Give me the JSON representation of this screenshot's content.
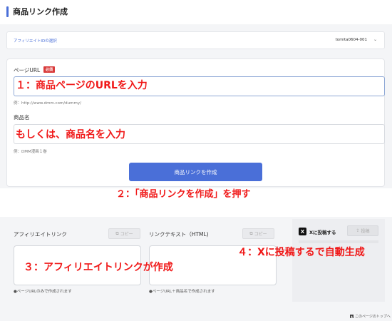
{
  "header": {
    "title": "商品リンク作成"
  },
  "affiliate_id": {
    "label": "アフィリエイトIDの選択",
    "value": "tomita0604-001",
    "chevron": "⌄"
  },
  "form": {
    "url_label": "ページURL",
    "required_badge": "必須",
    "url_value": "",
    "url_example": "例：http://www.dmm.com/dummy/",
    "name_label": "商品名",
    "name_value": "",
    "name_example": "例：DMM漫画１巻",
    "submit_label": "商品リンクを作成"
  },
  "results": {
    "affiliate_link_title": "アフィリエイトリンク",
    "link_text_title": "リンクテキスト（HTML)",
    "copy_label": "コピー",
    "affiliate_note": "●ページURLのみで作成されます",
    "link_text_note": "●ページURL＋商品名で作成されます"
  },
  "x_post": {
    "logo": "X",
    "label": "Xに投稿する",
    "post_label": "投稿"
  },
  "footer": {
    "page_top": "このページのトップへ"
  },
  "annotations": {
    "step1": "１：商品ページのURLを入力",
    "step1_alt": "もしくは、商品名を入力",
    "step2": "２：「商品リンクを作成」を押す",
    "step3": "３：アフィリエイトリンクが作成",
    "step4": "４：Xに投稿するで自動生成"
  },
  "colors": {
    "accent": "#4a6fd8",
    "required": "#d93c3c",
    "annotation": "#f01818"
  }
}
